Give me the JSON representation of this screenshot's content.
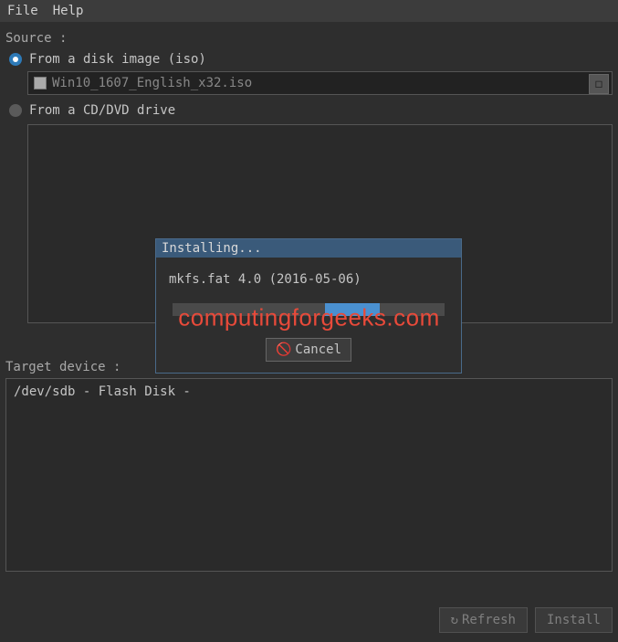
{
  "menubar": {
    "file": "File",
    "help": "Help"
  },
  "source": {
    "label": "Source :",
    "from_iso": "From a disk image (iso)",
    "iso_file": "Win10_1607_English_x32.iso",
    "from_cd": "From a CD/DVD drive"
  },
  "target": {
    "label": "Target device :",
    "device": "/dev/sdb - Flash Disk -"
  },
  "buttons": {
    "refresh": "Refresh",
    "install": "Install"
  },
  "dialog": {
    "title": "Installing...",
    "message": "mkfs.fat 4.0 (2016-05-06)",
    "cancel": "Cancel"
  },
  "watermark": "computingforgeeks.com"
}
